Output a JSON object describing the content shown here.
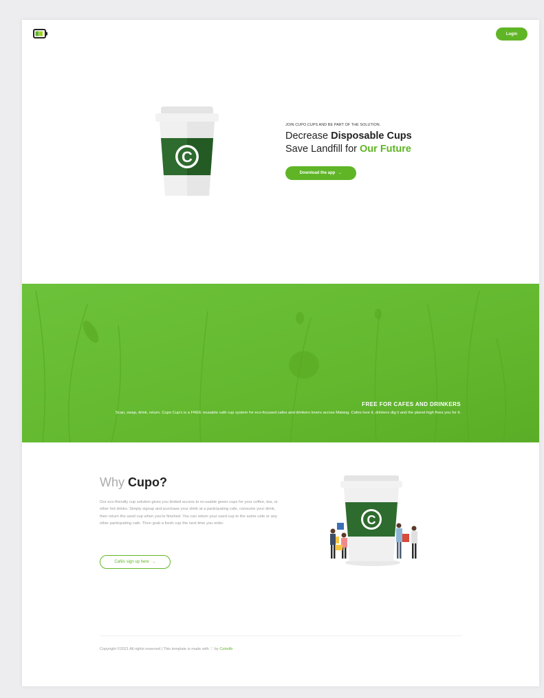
{
  "header": {
    "login_label": "Login"
  },
  "hero": {
    "kicker": "JOIN CUPO CUPS AND BE PART OF THE SOLUTION.",
    "line1_prefix": "Decrease ",
    "line1_bold": "Disposable Cups",
    "line2_prefix": "Save Landfill for ",
    "line2_green": "Our Future",
    "download_label": "Download the app",
    "download_arrow": "→",
    "cup_letter": "C"
  },
  "band": {
    "title": "FREE FOR CAFES AND DRINKERS",
    "text": "Scan, swap, drink, return. Cupo Cup's is a FREE reusable café cup system for eco-focused cafes and drinkers lovers across Malang. Cafes love it, drinkers dig it and the planet high fives you for it."
  },
  "why": {
    "title_light": "Why ",
    "title_bold": "Cupo?",
    "text": "Our eco-friendly cup solution gives you limited access to re-usable green cups for your coffee, tea, or other hot drinks. Simply signup and purchase your drink at a participating cafe, consume your drink, then return the used cup when you're finished. You can return your used cup to the same cafe or any other participating cafe. Then grab a fresh cup the next time you order.",
    "button_label": "Cafés sign up here",
    "button_arrow": "→",
    "cup_letter": "C"
  },
  "footer": {
    "prefix": "Copyright ©2021 All rights reserved | This template is made with ",
    "heart": "♡",
    "by": " by ",
    "brand": "Colorlib"
  },
  "colors": {
    "accent": "#5fb526",
    "cup_green": "#2e6b2e",
    "band_green": "#66bd32"
  },
  "icons": {
    "logo": "battery-icon",
    "arrow": "arrow-right-icon",
    "heart": "heart-icon"
  }
}
